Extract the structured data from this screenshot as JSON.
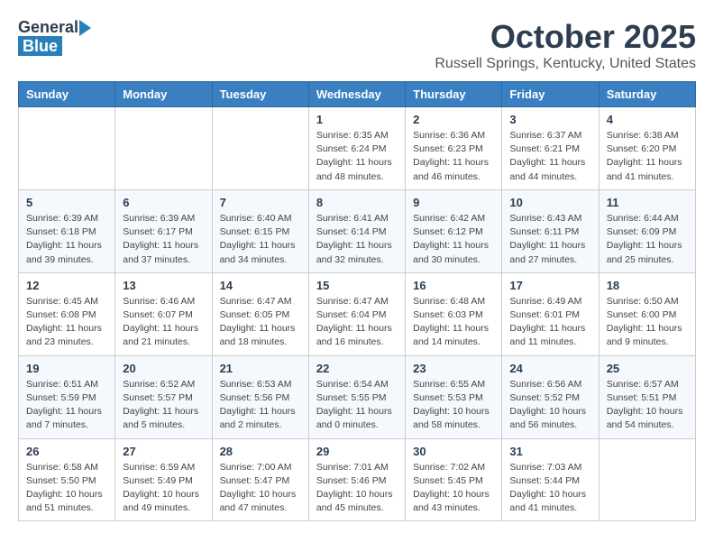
{
  "header": {
    "logo_general": "General",
    "logo_blue": "Blue",
    "month_title": "October 2025",
    "subtitle": "Russell Springs, Kentucky, United States"
  },
  "weekdays": [
    "Sunday",
    "Monday",
    "Tuesday",
    "Wednesday",
    "Thursday",
    "Friday",
    "Saturday"
  ],
  "weeks": [
    [
      {
        "day": "",
        "info": ""
      },
      {
        "day": "",
        "info": ""
      },
      {
        "day": "",
        "info": ""
      },
      {
        "day": "1",
        "info": "Sunrise: 6:35 AM\nSunset: 6:24 PM\nDaylight: 11 hours\nand 48 minutes."
      },
      {
        "day": "2",
        "info": "Sunrise: 6:36 AM\nSunset: 6:23 PM\nDaylight: 11 hours\nand 46 minutes."
      },
      {
        "day": "3",
        "info": "Sunrise: 6:37 AM\nSunset: 6:21 PM\nDaylight: 11 hours\nand 44 minutes."
      },
      {
        "day": "4",
        "info": "Sunrise: 6:38 AM\nSunset: 6:20 PM\nDaylight: 11 hours\nand 41 minutes."
      }
    ],
    [
      {
        "day": "5",
        "info": "Sunrise: 6:39 AM\nSunset: 6:18 PM\nDaylight: 11 hours\nand 39 minutes."
      },
      {
        "day": "6",
        "info": "Sunrise: 6:39 AM\nSunset: 6:17 PM\nDaylight: 11 hours\nand 37 minutes."
      },
      {
        "day": "7",
        "info": "Sunrise: 6:40 AM\nSunset: 6:15 PM\nDaylight: 11 hours\nand 34 minutes."
      },
      {
        "day": "8",
        "info": "Sunrise: 6:41 AM\nSunset: 6:14 PM\nDaylight: 11 hours\nand 32 minutes."
      },
      {
        "day": "9",
        "info": "Sunrise: 6:42 AM\nSunset: 6:12 PM\nDaylight: 11 hours\nand 30 minutes."
      },
      {
        "day": "10",
        "info": "Sunrise: 6:43 AM\nSunset: 6:11 PM\nDaylight: 11 hours\nand 27 minutes."
      },
      {
        "day": "11",
        "info": "Sunrise: 6:44 AM\nSunset: 6:09 PM\nDaylight: 11 hours\nand 25 minutes."
      }
    ],
    [
      {
        "day": "12",
        "info": "Sunrise: 6:45 AM\nSunset: 6:08 PM\nDaylight: 11 hours\nand 23 minutes."
      },
      {
        "day": "13",
        "info": "Sunrise: 6:46 AM\nSunset: 6:07 PM\nDaylight: 11 hours\nand 21 minutes."
      },
      {
        "day": "14",
        "info": "Sunrise: 6:47 AM\nSunset: 6:05 PM\nDaylight: 11 hours\nand 18 minutes."
      },
      {
        "day": "15",
        "info": "Sunrise: 6:47 AM\nSunset: 6:04 PM\nDaylight: 11 hours\nand 16 minutes."
      },
      {
        "day": "16",
        "info": "Sunrise: 6:48 AM\nSunset: 6:03 PM\nDaylight: 11 hours\nand 14 minutes."
      },
      {
        "day": "17",
        "info": "Sunrise: 6:49 AM\nSunset: 6:01 PM\nDaylight: 11 hours\nand 11 minutes."
      },
      {
        "day": "18",
        "info": "Sunrise: 6:50 AM\nSunset: 6:00 PM\nDaylight: 11 hours\nand 9 minutes."
      }
    ],
    [
      {
        "day": "19",
        "info": "Sunrise: 6:51 AM\nSunset: 5:59 PM\nDaylight: 11 hours\nand 7 minutes."
      },
      {
        "day": "20",
        "info": "Sunrise: 6:52 AM\nSunset: 5:57 PM\nDaylight: 11 hours\nand 5 minutes."
      },
      {
        "day": "21",
        "info": "Sunrise: 6:53 AM\nSunset: 5:56 PM\nDaylight: 11 hours\nand 2 minutes."
      },
      {
        "day": "22",
        "info": "Sunrise: 6:54 AM\nSunset: 5:55 PM\nDaylight: 11 hours\nand 0 minutes."
      },
      {
        "day": "23",
        "info": "Sunrise: 6:55 AM\nSunset: 5:53 PM\nDaylight: 10 hours\nand 58 minutes."
      },
      {
        "day": "24",
        "info": "Sunrise: 6:56 AM\nSunset: 5:52 PM\nDaylight: 10 hours\nand 56 minutes."
      },
      {
        "day": "25",
        "info": "Sunrise: 6:57 AM\nSunset: 5:51 PM\nDaylight: 10 hours\nand 54 minutes."
      }
    ],
    [
      {
        "day": "26",
        "info": "Sunrise: 6:58 AM\nSunset: 5:50 PM\nDaylight: 10 hours\nand 51 minutes."
      },
      {
        "day": "27",
        "info": "Sunrise: 6:59 AM\nSunset: 5:49 PM\nDaylight: 10 hours\nand 49 minutes."
      },
      {
        "day": "28",
        "info": "Sunrise: 7:00 AM\nSunset: 5:47 PM\nDaylight: 10 hours\nand 47 minutes."
      },
      {
        "day": "29",
        "info": "Sunrise: 7:01 AM\nSunset: 5:46 PM\nDaylight: 10 hours\nand 45 minutes."
      },
      {
        "day": "30",
        "info": "Sunrise: 7:02 AM\nSunset: 5:45 PM\nDaylight: 10 hours\nand 43 minutes."
      },
      {
        "day": "31",
        "info": "Sunrise: 7:03 AM\nSunset: 5:44 PM\nDaylight: 10 hours\nand 41 minutes."
      },
      {
        "day": "",
        "info": ""
      }
    ]
  ]
}
